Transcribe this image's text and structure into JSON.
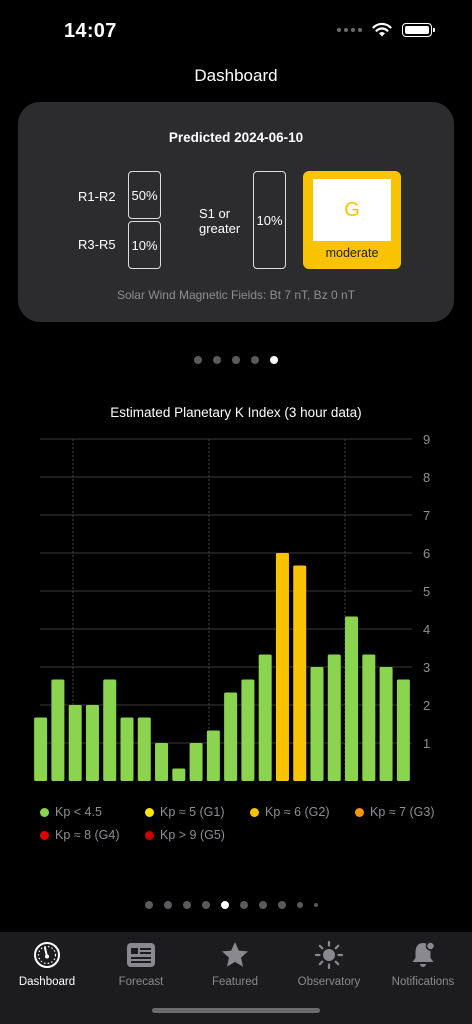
{
  "status_bar": {
    "time": "14:07"
  },
  "nav": {
    "title": "Dashboard"
  },
  "prediction": {
    "title": "Predicted 2024-06-10",
    "r1r2": {
      "label": "R1-R2",
      "value": "50%"
    },
    "r3r5": {
      "label": "R3-R5",
      "value": "10%"
    },
    "s1": {
      "label_line1": "S1 or",
      "label_line2": "greater",
      "value": "10%"
    },
    "g": {
      "letter": "G",
      "level": "moderate",
      "color": "#f9c300"
    },
    "footer": "Solar Wind Magnetic Fields: Bt 7 nT, Bz 0 nT"
  },
  "card_pager": {
    "count": 5,
    "active": 4
  },
  "chart_data": {
    "type": "bar",
    "title": "Estimated Planetary K Index (3 hour data)",
    "ylim": [
      0,
      9
    ],
    "yticks": [
      "1",
      "2",
      "3",
      "4",
      "5",
      "6",
      "7",
      "8",
      "9"
    ],
    "grid": true,
    "values": [
      1.67,
      2.67,
      2.0,
      2.0,
      2.67,
      1.67,
      1.67,
      1.0,
      0.33,
      1.0,
      1.33,
      2.33,
      2.67,
      3.33,
      6.0,
      5.67,
      3.0,
      3.33,
      4.33,
      3.33,
      3.0,
      2.67
    ],
    "colors": [
      "#8bd450",
      "#8bd450",
      "#8bd450",
      "#8bd450",
      "#8bd450",
      "#8bd450",
      "#8bd450",
      "#8bd450",
      "#8bd450",
      "#8bd450",
      "#8bd450",
      "#8bd450",
      "#8bd450",
      "#8bd450",
      "#f9c300",
      "#f9c300",
      "#8bd450",
      "#8bd450",
      "#8bd450",
      "#8bd450",
      "#8bd450",
      "#8bd450"
    ],
    "legend": [
      {
        "label": "Kp < 4.5",
        "color": "#8bd450"
      },
      {
        "label": "Kp ≈ 5 (G1)",
        "color": "#ffe600"
      },
      {
        "label": "Kp ≈ 6 (G2)",
        "color": "#f9c300"
      },
      {
        "label": "Kp ≈ 7 (G3)",
        "color": "#ff9500"
      },
      {
        "label": "Kp ≈ 8 (G4)",
        "color": "#e00000"
      },
      {
        "label": "Kp > 9 (G5)",
        "color": "#c80000"
      }
    ]
  },
  "chart_pager": {
    "count": 10,
    "active": 4
  },
  "tabs": [
    {
      "label": "Dashboard",
      "icon": "gauge-icon",
      "active": true
    },
    {
      "label": "Forecast",
      "icon": "newspaper-icon",
      "active": false
    },
    {
      "label": "Featured",
      "icon": "star-icon",
      "active": false
    },
    {
      "label": "Observatory",
      "icon": "sun-icon",
      "active": false
    },
    {
      "label": "Notifications",
      "icon": "bell-icon",
      "active": false
    }
  ]
}
